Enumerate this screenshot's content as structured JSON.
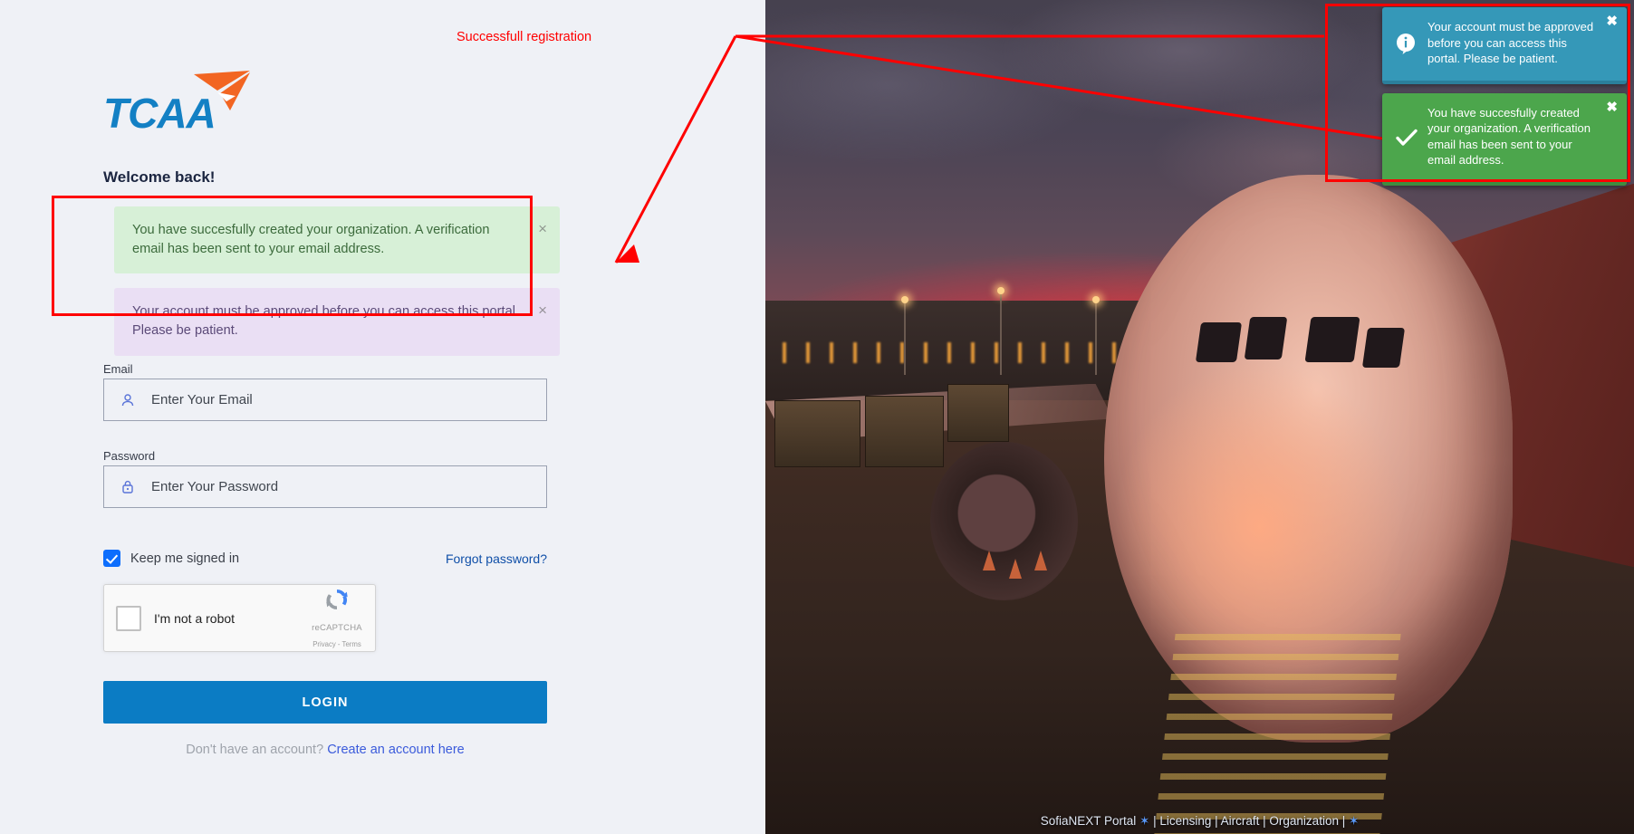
{
  "annotation": {
    "caption": "Successfull registration",
    "caption_color": "#ff0000",
    "box_color": "#ff0000"
  },
  "brand": {
    "logo_text": "TCAA",
    "logo_icon": "paper-plane-icon",
    "logo_blue": "#1380c4",
    "logo_orange": "#f26522"
  },
  "login": {
    "heading": "Welcome back!",
    "alerts": [
      {
        "type": "success",
        "message": "You have succesfully created your organization. A verification email has been sent to your email address.",
        "close_label": "×"
      },
      {
        "type": "info",
        "message": "Your account must be approved before you can access this portal. Please be patient.",
        "close_label": "×"
      }
    ],
    "email": {
      "label": "Email",
      "placeholder": "Enter Your Email",
      "value": "",
      "icon": "user-icon"
    },
    "password": {
      "label": "Password",
      "placeholder": "Enter Your Password",
      "value": "",
      "icon": "lock-icon"
    },
    "keep_signed_in": {
      "label": "Keep me signed in",
      "checked": true
    },
    "forgot_password_label": "Forgot password?",
    "recaptcha": {
      "checkbox_label": "I'm not a robot",
      "brand": "reCAPTCHA",
      "links": "Privacy - Terms",
      "checked": false
    },
    "submit_label": "LOGIN",
    "signup_prompt": "Don't have an account?",
    "signup_link": "Create an account here",
    "accent_color": "#0b7cc4"
  },
  "toasts": [
    {
      "type": "info",
      "icon": "info-circle-icon",
      "message": "Your account must be approved before you can access this portal. Please be patient.",
      "close_label": "✖",
      "color": "#3598b8"
    },
    {
      "type": "success",
      "icon": "check-icon",
      "message": "You have succesfully created your organization. A verification email has been sent to your email address.",
      "close_label": "✖",
      "color": "#4ca64c"
    }
  ],
  "photo": {
    "alt": "airliner-at-gate-at-dusk",
    "footer_prefix": "SofiaNEXT Portal",
    "footer_star1": "✶",
    "footer_middle": "| Licensing | Aircraft | Organization |",
    "footer_star2": "✶"
  }
}
